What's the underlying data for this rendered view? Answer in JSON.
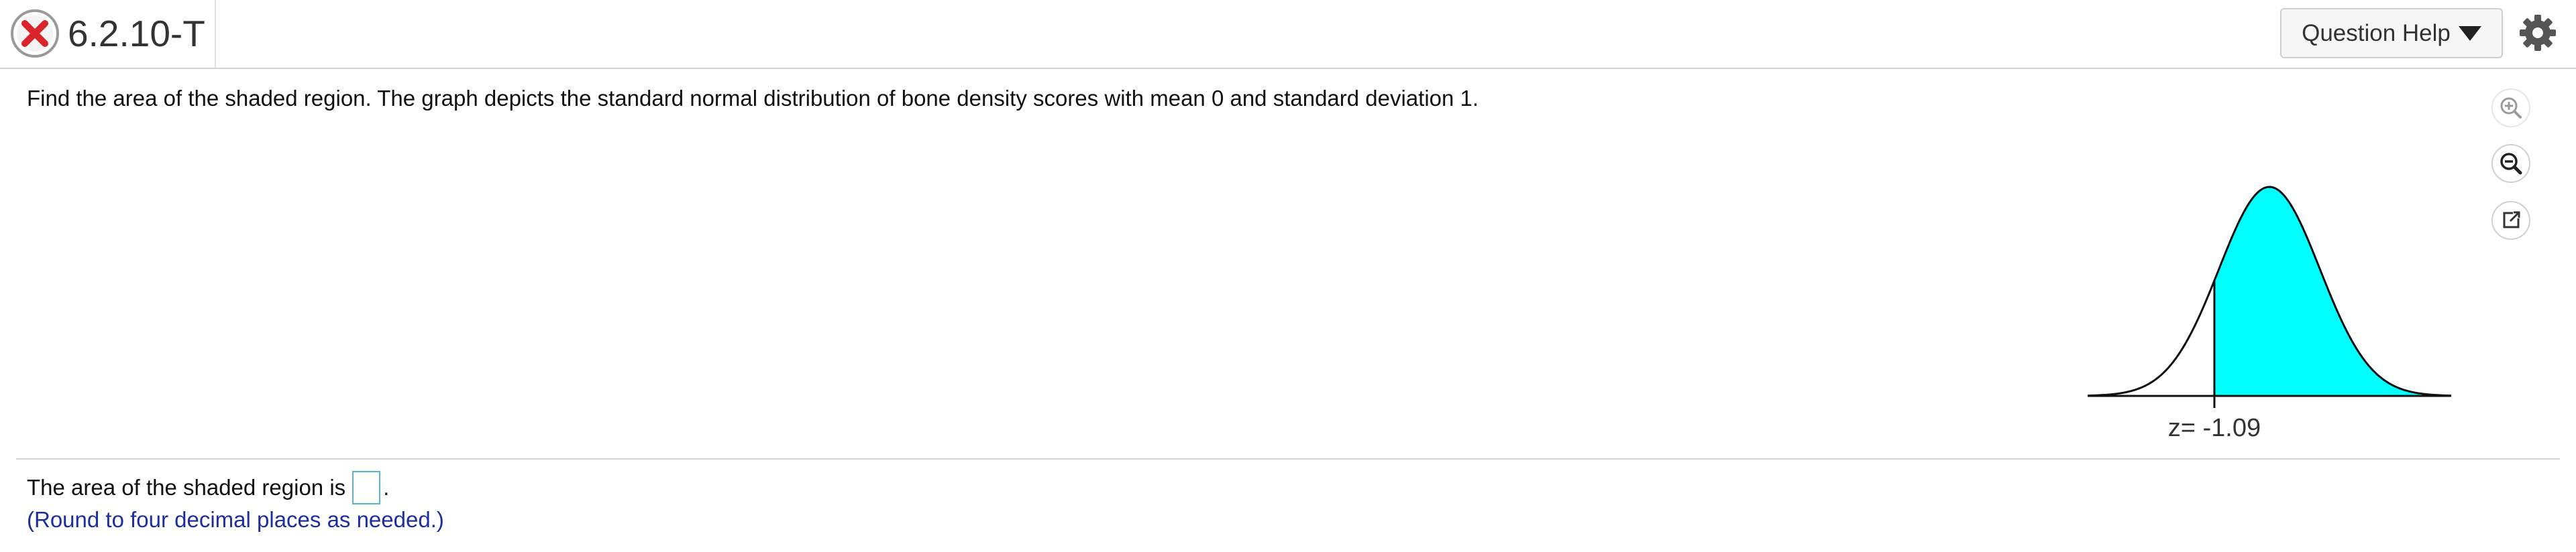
{
  "header": {
    "question_id": "6.2.10-T",
    "status_icon": "incorrect-x-icon",
    "help_label": "Question Help",
    "settings_icon": "gear-icon"
  },
  "question": {
    "prompt": "Find the area of the shaded region. The graph depicts the standard normal distribution of bone density scores with mean 0 and standard deviation 1."
  },
  "tools": {
    "icons": [
      "zoom-in-icon",
      "zoom-out-icon",
      "popout-icon"
    ]
  },
  "graph": {
    "z_label": "z= -1.09",
    "z_value": -1.09,
    "shade_color": "#00ffff"
  },
  "answer": {
    "prefix": "The area of the shaded region is",
    "suffix": ".",
    "input_value": "",
    "note": "(Round to four decimal places as needed.)"
  },
  "colors": {
    "note_text": "#1c2ea0",
    "incorrect": "#d9252a",
    "input_border": "#5ab4d6"
  }
}
